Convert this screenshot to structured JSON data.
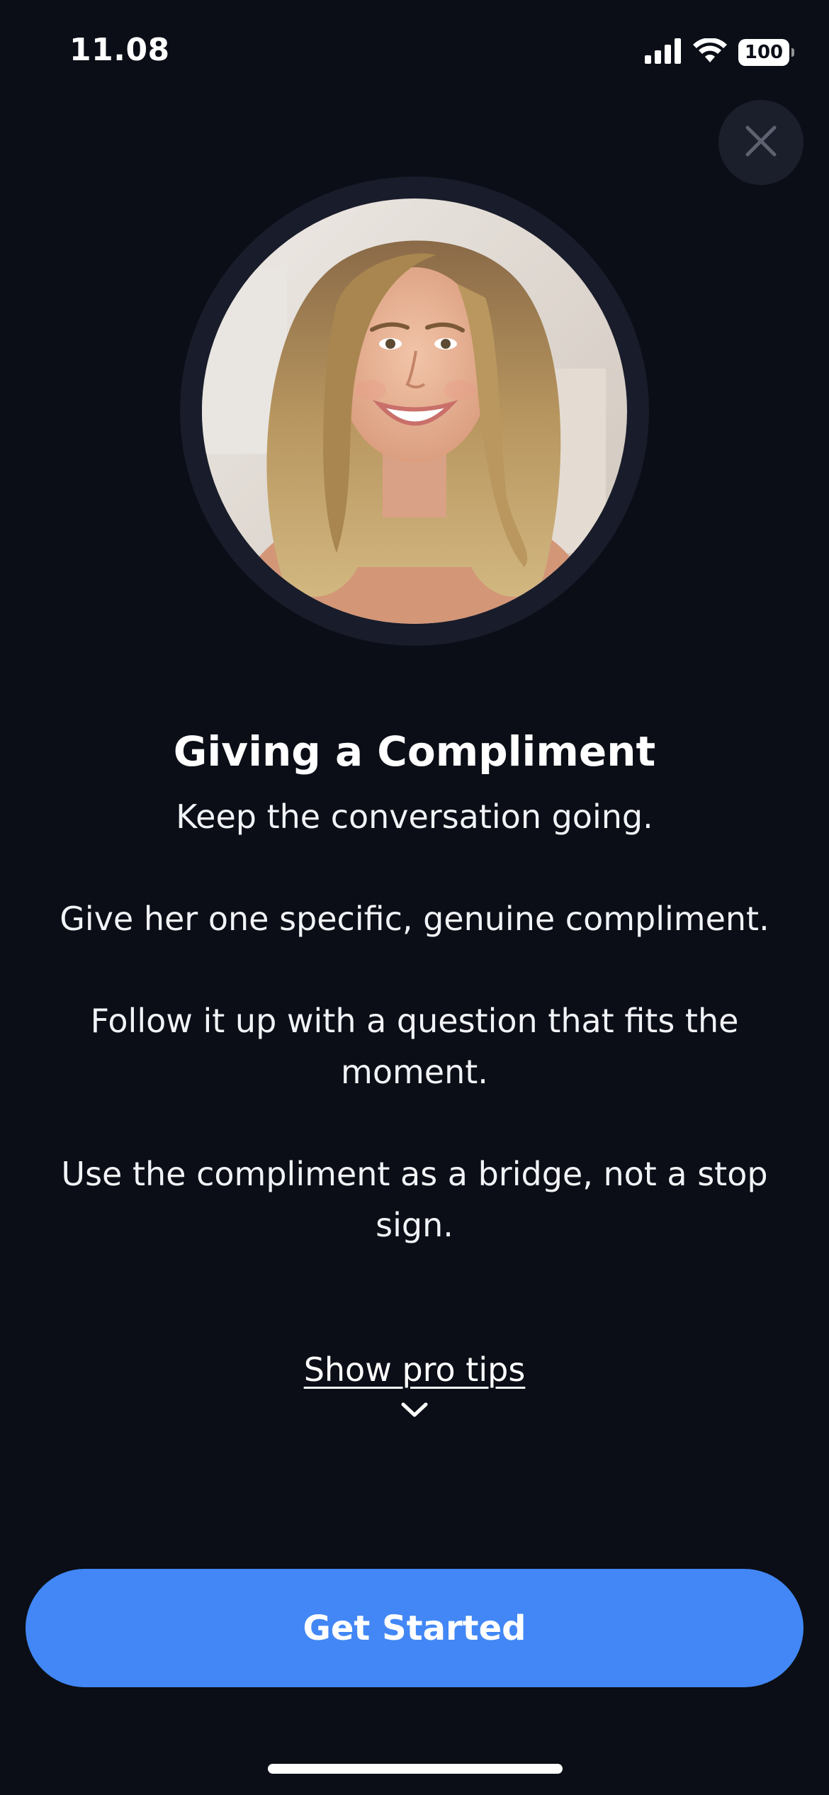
{
  "status_bar": {
    "time": "11.08",
    "battery_level": "100",
    "icons": [
      "cellular-signal-icon",
      "wifi-icon",
      "battery-icon"
    ]
  },
  "close_button": {
    "icon": "close-icon"
  },
  "avatar": {
    "icon": "profile-photo"
  },
  "lesson": {
    "title": "Giving a Compliment",
    "paragraphs": [
      "Keep the conversation going.",
      "Give her one specific, genuine compliment.",
      "Follow it up with a question that fits the moment.",
      "Use the compliment as a bridge, not a stop sign."
    ]
  },
  "pro_tips": {
    "label": "Show pro tips",
    "icon": "chevron-down-icon"
  },
  "cta": {
    "label": "Get Started"
  },
  "colors": {
    "background": "#0b0e16",
    "accent": "#4287f5",
    "close_bg": "#1b1e2b",
    "avatar_ring": "#191c2a"
  }
}
